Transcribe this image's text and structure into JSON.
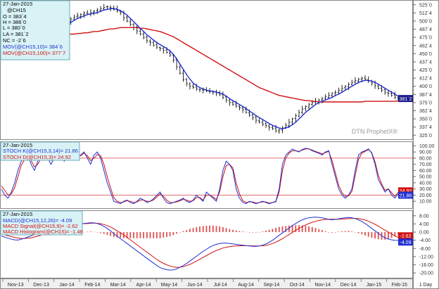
{
  "chart_data": [
    {
      "type": "ohlc",
      "panel": "price",
      "date": "27-Jan-2015",
      "symbol": "@CH15",
      "readout": {
        "O": "383`4",
        "H": "386`0",
        "L": "380`0",
        "LA": "381`2",
        "NC": "-2`6"
      },
      "moving_averages": [
        {
          "label": "MOV(@CH15,10)= 384`6",
          "color": "#2030d0"
        },
        {
          "label": "MOV(@CH15,100)= 377`7",
          "color": "#d01010"
        }
      ],
      "y_ticks": [
        "525`0",
        "512`4",
        "500`0",
        "487`4",
        "475`0",
        "462`4",
        "450`0",
        "437`4",
        "425`0",
        "412`4",
        "400`0",
        "387`4",
        "375`0",
        "362`4",
        "350`0",
        "337`4",
        "325`0"
      ],
      "y_tick_values": [
        525,
        512.5,
        500,
        487.5,
        475,
        462.5,
        450,
        437.5,
        425,
        412.5,
        400,
        387.5,
        375,
        362.5,
        350,
        337.5,
        325
      ],
      "ylim": [
        321,
        528
      ],
      "last_value_label": "381`2",
      "last_value": 381.25,
      "watermark": "DTN ProphetX®",
      "close_series": [
        470,
        468,
        466,
        464,
        462,
        460,
        461,
        463,
        465,
        466,
        467,
        470,
        472,
        474,
        478,
        482,
        486,
        488,
        492,
        496,
        500,
        503,
        506,
        508,
        510,
        512,
        511,
        513,
        515,
        517,
        519,
        521,
        522,
        520,
        518,
        516,
        513,
        505,
        500,
        495,
        490,
        485,
        480,
        475,
        470,
        467,
        463,
        460,
        458,
        455,
        452,
        448,
        440,
        430,
        420,
        410,
        404,
        400,
        398,
        396,
        395,
        394,
        393,
        392,
        391,
        390,
        387,
        383,
        379,
        375,
        372,
        370,
        367,
        364,
        360,
        356,
        352,
        348,
        345,
        342,
        340,
        337,
        335,
        332,
        333,
        336,
        340,
        345,
        350,
        355,
        360,
        365,
        369,
        372,
        375,
        377,
        379,
        381,
        384,
        386,
        389,
        391,
        394,
        397,
        400,
        403,
        406,
        409,
        411,
        412,
        411,
        408,
        405,
        401,
        397,
        394,
        391,
        389,
        386,
        383,
        381.25
      ],
      "ma10_series": [
        468,
        467,
        466,
        465,
        463,
        462,
        461,
        461,
        462,
        463,
        465,
        467,
        469,
        471,
        474,
        477,
        480,
        484,
        487,
        491,
        495,
        498,
        501,
        504,
        506,
        508,
        510,
        511,
        512,
        513,
        515,
        517,
        518,
        519,
        519,
        518,
        516,
        513,
        509,
        504,
        499,
        494,
        489,
        484,
        479,
        475,
        471,
        467,
        464,
        461,
        458,
        454,
        449,
        442,
        434,
        426,
        418,
        411,
        405,
        401,
        398,
        396,
        394,
        393,
        392,
        391,
        390,
        388,
        385,
        381,
        378,
        375,
        372,
        369,
        366,
        362,
        359,
        355,
        352,
        349,
        346,
        343,
        340,
        338,
        336,
        335,
        336,
        338,
        341,
        345,
        350,
        355,
        360,
        364,
        368,
        372,
        375,
        377,
        379,
        381,
        383,
        386,
        388,
        391,
        394,
        397,
        400,
        403,
        406,
        408,
        409,
        409,
        408,
        406,
        403,
        400,
        397,
        394,
        391,
        388,
        384.75
      ],
      "ma100_series": [
        496,
        495,
        494,
        493,
        492,
        491,
        490,
        489,
        488,
        487,
        486,
        485,
        484,
        483,
        482,
        481,
        481,
        480,
        480,
        480,
        480,
        480,
        480,
        481,
        481,
        482,
        482,
        483,
        484,
        484,
        485,
        486,
        487,
        488,
        488,
        489,
        490,
        490,
        490,
        490,
        490,
        490,
        489,
        489,
        488,
        487,
        486,
        485,
        484,
        482,
        480,
        478,
        476,
        473,
        470,
        467,
        464,
        461,
        458,
        455,
        452,
        449,
        446,
        443,
        440,
        437,
        434,
        431,
        428,
        425,
        422,
        419,
        416,
        413,
        410,
        407,
        404,
        401,
        398,
        396,
        394,
        392,
        390,
        388,
        386,
        385,
        384,
        383,
        382,
        381,
        380,
        379,
        378,
        378,
        377,
        377,
        376,
        376,
        376,
        376,
        376,
        376,
        376,
        376,
        376,
        376,
        376,
        376,
        376,
        376,
        377,
        377,
        377,
        377,
        377,
        377,
        377,
        377,
        377,
        377,
        377.7
      ]
    },
    {
      "type": "line",
      "panel": "stochastic",
      "date": "27-Jan-2015",
      "series_labels": [
        {
          "label": "STOCH K(@CH15,3,14)= 21.86",
          "color": "#2030d0"
        },
        {
          "label": "STOCH D(@CH15,3)= 24.92",
          "color": "#d01010"
        }
      ],
      "y_ticks": [
        "100.00",
        "90.00",
        "80.00",
        "70.00",
        "60.00",
        "50.00",
        "40.00",
        "30.00",
        "20.00",
        "10.00"
      ],
      "y_tick_values": [
        100,
        90,
        80,
        70,
        60,
        50,
        40,
        30,
        20,
        10
      ],
      "ylim": [
        0,
        105
      ],
      "reference_lines": [
        80,
        20
      ],
      "last_value_labels": [
        {
          "text": "24.92",
          "value": 24.92,
          "color": "#d01010"
        },
        {
          "text": "21.86",
          "value": 21.86,
          "color": "#2030d0"
        }
      ],
      "k_series": [
        30,
        20,
        15,
        25,
        40,
        60,
        75,
        80,
        85,
        70,
        60,
        75,
        85,
        90,
        80,
        70,
        80,
        90,
        85,
        75,
        85,
        95,
        90,
        80,
        85,
        90,
        80,
        70,
        85,
        90,
        80,
        60,
        40,
        25,
        10,
        8,
        6,
        10,
        12,
        8,
        6,
        10,
        15,
        12,
        8,
        10,
        14,
        20,
        25,
        15,
        8,
        6,
        8,
        10,
        12,
        15,
        10,
        8,
        12,
        20,
        15,
        10,
        25,
        20,
        15,
        10,
        30,
        60,
        75,
        70,
        60,
        30,
        15,
        8,
        6,
        10,
        8,
        6,
        8,
        10,
        8,
        6,
        8,
        10,
        30,
        70,
        85,
        90,
        95,
        92,
        90,
        94,
        96,
        95,
        92,
        90,
        88,
        85,
        90,
        92,
        70,
        50,
        30,
        20,
        15,
        20,
        30,
        60,
        85,
        90,
        92,
        95,
        88,
        70,
        45,
        35,
        25,
        30,
        20,
        15,
        21.86
      ],
      "d_series": [
        35,
        28,
        20,
        22,
        32,
        50,
        68,
        78,
        82,
        76,
        66,
        70,
        80,
        86,
        84,
        76,
        78,
        86,
        86,
        80,
        82,
        90,
        90,
        84,
        84,
        88,
        84,
        76,
        80,
        86,
        84,
        70,
        50,
        32,
        16,
        10,
        8,
        9,
        11,
        10,
        8,
        9,
        12,
        12,
        10,
        10,
        12,
        17,
        22,
        18,
        12,
        8,
        8,
        9,
        11,
        13,
        12,
        10,
        11,
        16,
        16,
        12,
        20,
        20,
        17,
        13,
        25,
        50,
        68,
        70,
        64,
        40,
        22,
        11,
        8,
        9,
        9,
        7,
        8,
        9,
        9,
        7,
        8,
        9,
        25,
        60,
        80,
        88,
        92,
        92,
        91,
        93,
        95,
        95,
        93,
        91,
        89,
        87,
        89,
        91,
        76,
        56,
        36,
        24,
        18,
        19,
        26,
        52,
        78,
        88,
        91,
        94,
        89,
        74,
        52,
        38,
        28,
        30,
        24,
        18,
        24.92
      ]
    },
    {
      "type": "bar+line",
      "panel": "macd",
      "date": "27-Jan-2015",
      "series_labels": [
        {
          "label": "MACD(@CH15,12,26)= -4.09",
          "color": "#2030d0"
        },
        {
          "label": "MACD Signal(@CH15,9)= -2.62",
          "color": "#d01010"
        },
        {
          "label": "MACD Histogram(@CH15)= -1.48",
          "color": "#d01010"
        }
      ],
      "y_ticks": [
        "8.00",
        "4.00",
        "0.00",
        "-4.00",
        "-8.00",
        "-12.00",
        "-16.00",
        "-20.00"
      ],
      "y_tick_values": [
        8,
        4,
        0,
        -4,
        -8,
        -12,
        -16,
        -20
      ],
      "ylim": [
        -22,
        10
      ],
      "last_value_labels": [
        {
          "text": "-2.62",
          "value": -2.62,
          "color": "#d01010"
        },
        {
          "text": "-4.09",
          "value": -4.09,
          "color": "#2030d0"
        }
      ],
      "macd_series": [
        -2,
        -2.5,
        -3,
        -3.5,
        -3.8,
        -3.9,
        -3.5,
        -3,
        -2.4,
        -1.8,
        -1.2,
        -0.5,
        0.2,
        0.8,
        1.5,
        2.2,
        2.8,
        3.2,
        3.6,
        4,
        4.2,
        4.4,
        4.6,
        4.5,
        4.3,
        4.2,
        4.4,
        4.6,
        4.5,
        4.2,
        3.6,
        2.8,
        1.8,
        0.6,
        -0.8,
        -2,
        -3.2,
        -4.4,
        -5.6,
        -6.8,
        -8,
        -9.2,
        -10.4,
        -11.6,
        -12.8,
        -14,
        -15.2,
        -16.4,
        -17.4,
        -18,
        -18.4,
        -18.6,
        -18.5,
        -18,
        -17.2,
        -16.4,
        -15.4,
        -14.2,
        -13,
        -11.8,
        -10.6,
        -9.4,
        -8.4,
        -7.4,
        -6.6,
        -6,
        -5.6,
        -5.4,
        -5.4,
        -5.6,
        -5.8,
        -6,
        -6.2,
        -6.4,
        -6.6,
        -6.8,
        -7,
        -7,
        -6.8,
        -6.4,
        -5.8,
        -5,
        -4,
        -2.8,
        -1.6,
        -0.4,
        0.8,
        2,
        3.2,
        4.2,
        5.2,
        6,
        6.6,
        7,
        7.2,
        7.3,
        7.2,
        7,
        6.6,
        6.2,
        6,
        6.2,
        6.5,
        6.8,
        7,
        7.2,
        7,
        6.6,
        6,
        5.2,
        4.2,
        3,
        1.8,
        0.6,
        -0.6,
        -1.8,
        -2.8,
        -3.4,
        -3.8,
        -4,
        -4.09
      ],
      "signal_series": [
        -1,
        -1.4,
        -1.8,
        -2.2,
        -2.6,
        -2.9,
        -3.1,
        -3.1,
        -3,
        -2.8,
        -2.4,
        -2,
        -1.5,
        -1,
        -0.4,
        0.2,
        0.8,
        1.4,
        2,
        2.5,
        3,
        3.4,
        3.7,
        3.9,
        4,
        4.1,
        4.2,
        4.3,
        4.4,
        4.3,
        4.1,
        3.7,
        3.2,
        2.5,
        1.6,
        0.6,
        -0.4,
        -1.4,
        -2.6,
        -3.8,
        -5,
        -6.2,
        -7.4,
        -8.6,
        -9.8,
        -11,
        -12.2,
        -13.4,
        -14.4,
        -15.3,
        -16,
        -16.6,
        -17,
        -17.2,
        -17.2,
        -16.9,
        -16.4,
        -15.8,
        -15,
        -14.2,
        -13.3,
        -12.4,
        -11.5,
        -10.6,
        -9.8,
        -9,
        -8.4,
        -7.8,
        -7.4,
        -7.1,
        -6.9,
        -6.8,
        -6.7,
        -6.7,
        -6.7,
        -6.7,
        -6.8,
        -6.8,
        -6.8,
        -6.7,
        -6.5,
        -6.1,
        -5.6,
        -4.9,
        -4.1,
        -3.2,
        -2.2,
        -1.2,
        -0.2,
        0.8,
        1.8,
        2.7,
        3.5,
        4.2,
        4.8,
        5.3,
        5.7,
        6,
        6.2,
        6.3,
        6.3,
        6.3,
        6.3,
        6.4,
        6.5,
        6.6,
        6.7,
        6.7,
        6.6,
        6.3,
        5.9,
        5.3,
        4.6,
        3.8,
        2.9,
        1.9,
        0.9,
        0,
        -0.9,
        -1.8,
        -2.62
      ]
    }
  ],
  "x_axis": {
    "labels": [
      "Nov-13",
      "Dec-13",
      "Jan-14",
      "Feb-14",
      "Mar-14",
      "Apr-14",
      "May-14",
      "Jun-14",
      "Jul-14",
      "Aug-14",
      "Sep-14",
      "Oct-14",
      "Nov-14",
      "Dec-14",
      "Jan-15",
      "Feb-15"
    ],
    "period_label": "1 Day"
  }
}
